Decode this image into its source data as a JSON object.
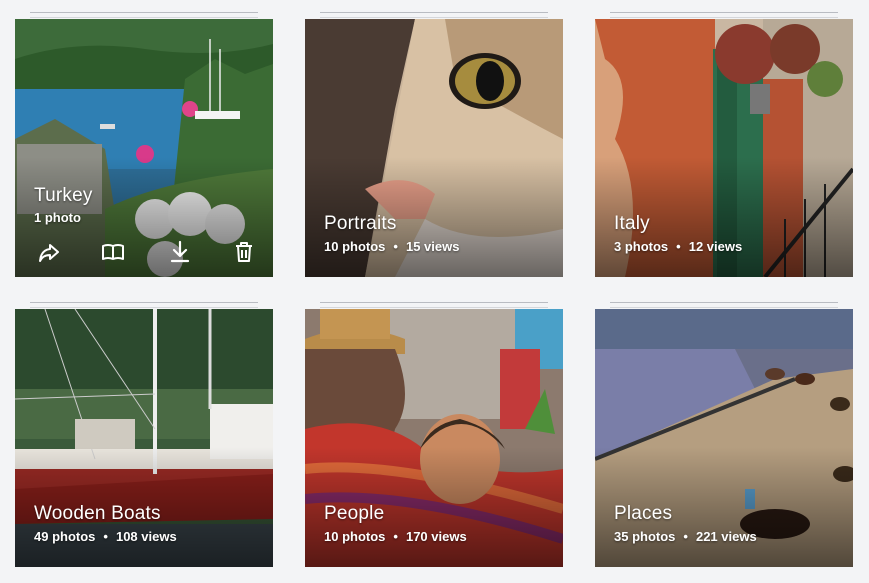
{
  "albums": [
    {
      "title": "Turkey",
      "photos": "1 photo",
      "views": ""
    },
    {
      "title": "Portraits",
      "photos": "10 photos",
      "views": "15 views"
    },
    {
      "title": "Italy",
      "photos": "3 photos",
      "views": "12 views"
    },
    {
      "title": "Wooden Boats",
      "photos": "49 photos",
      "views": "108 views"
    },
    {
      "title": "People",
      "photos": "10 photos",
      "views": "170 views"
    },
    {
      "title": "Places",
      "photos": "35 photos",
      "views": "221 views"
    }
  ],
  "separator": "•",
  "hover_actions": [
    "share-icon",
    "book-icon",
    "download-icon",
    "trash-icon"
  ]
}
